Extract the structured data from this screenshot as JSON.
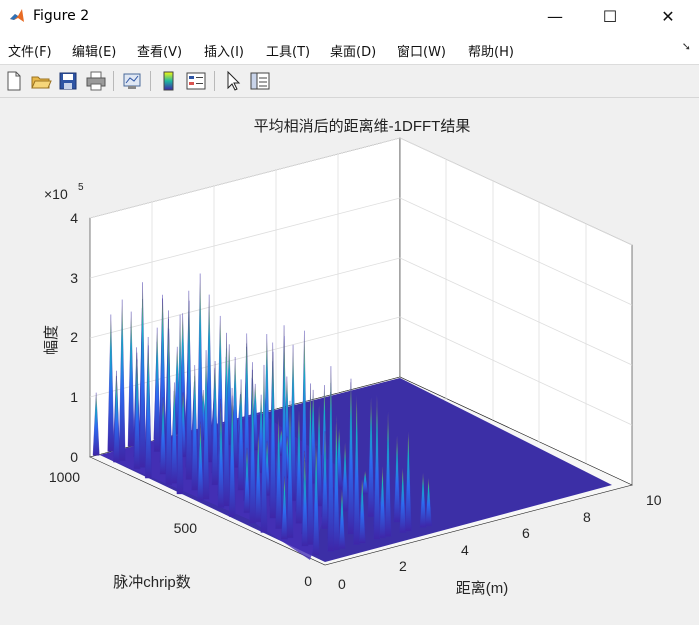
{
  "window": {
    "title": "Figure 2",
    "min_glyph": "—",
    "max_glyph": "☐",
    "close_glyph": "✕"
  },
  "menu": [
    "文件(F)",
    "编辑(E)",
    "查看(V)",
    "插入(I)",
    "工具(T)",
    "桌面(D)",
    "窗口(W)",
    "帮助(H)"
  ],
  "toolbar_icons": [
    "new-figure-icon",
    "open-file-icon",
    "save-icon",
    "print-icon",
    "link-plot-icon",
    "colorbar-icon",
    "legend-icon",
    "pointer-icon",
    "property-inspector-icon"
  ],
  "chart_data": {
    "type": "surface",
    "title": "平均相消后的距离维-1DFFT结果",
    "xlabel": "距离(m)",
    "ylabel": "脉冲chrip数",
    "zlabel": "幅度",
    "x_ticks": [
      "0",
      "2",
      "4",
      "6",
      "8",
      "10"
    ],
    "y_ticks": [
      "0",
      "500",
      "1000"
    ],
    "z_ticks": [
      "0",
      "1",
      "2",
      "3",
      "4"
    ],
    "z_exponent_base": "×10",
    "z_exponent_power": "5",
    "xlim": [
      0,
      10
    ],
    "ylim": [
      0,
      1000
    ],
    "zlim": [
      0,
      400000
    ],
    "grid": true,
    "colormap": "parula",
    "peak_profile": {
      "description_units": "amplitude",
      "x": [
        0.2,
        0.5,
        0.8,
        1.1,
        1.4,
        1.7,
        2.0,
        2.3,
        2.6,
        2.9,
        3.2,
        3.5,
        3.8
      ],
      "z": [
        300000,
        310000,
        320000,
        280000,
        340000,
        260000,
        300000,
        250000,
        240000,
        200000,
        180000,
        150000,
        80000
      ]
    }
  }
}
